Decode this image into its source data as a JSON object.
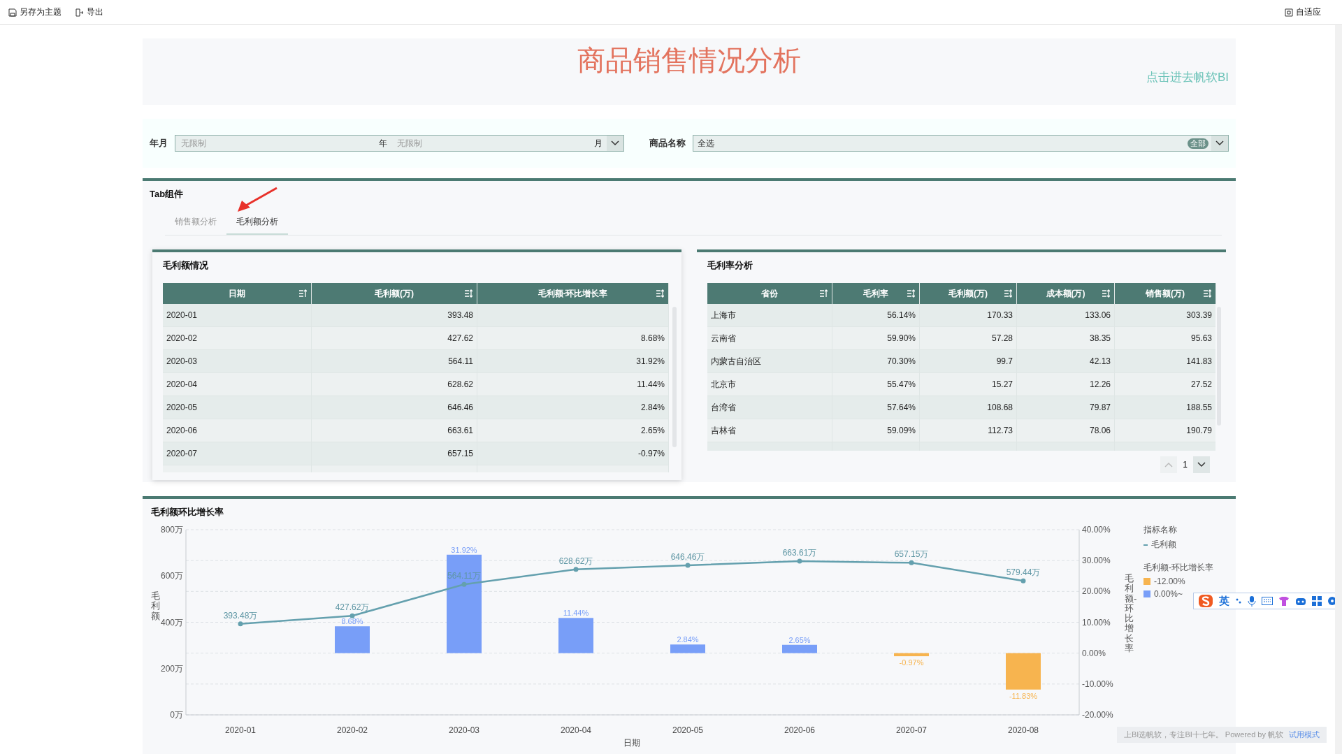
{
  "toolbar": {
    "left": [
      {
        "label": "另存为主题",
        "kind": "save"
      },
      {
        "label": "导出",
        "kind": "export"
      }
    ],
    "right": {
      "label": "自适应",
      "kind": "fit"
    }
  },
  "header": {
    "title": "商品销售情况分析",
    "link": "点击进去帆软BI"
  },
  "filters": [
    {
      "label": "年月",
      "kind": "range",
      "from": {
        "placeholder": "无限制",
        "unit": "年"
      },
      "to": {
        "placeholder": "无限制",
        "unit": "月"
      }
    },
    {
      "label": "商品名称",
      "kind": "select",
      "value": "全选",
      "badge": "全部"
    }
  ],
  "tab_panel": {
    "title": "Tab组件",
    "tabs": [
      {
        "label": "销售额分析",
        "selected": false
      },
      {
        "label": "毛利额分析",
        "selected": true
      }
    ]
  },
  "tables": [
    {
      "title": "毛利额情况",
      "columns": [
        {
          "label": "日期",
          "sorted": true
        },
        {
          "label": "毛利额(万)",
          "sorted": false
        },
        {
          "label": "毛利额-环比增长率",
          "sorted": false
        }
      ],
      "rows": [
        [
          "2020-01",
          "393.48",
          ""
        ],
        [
          "2020-02",
          "427.62",
          "8.68%"
        ],
        [
          "2020-03",
          "564.11",
          "31.92%"
        ],
        [
          "2020-04",
          "628.62",
          "11.44%"
        ],
        [
          "2020-05",
          "646.46",
          "2.84%"
        ],
        [
          "2020-06",
          "663.61",
          "2.65%"
        ],
        [
          "2020-07",
          "657.15",
          "-0.97%"
        ]
      ]
    },
    {
      "title": "毛利率分析",
      "columns": [
        {
          "label": "省份",
          "sorted": true
        },
        {
          "label": "毛利率",
          "sorted": false
        },
        {
          "label": "毛利额(万)",
          "sorted": false
        },
        {
          "label": "成本额(万)",
          "sorted": false
        },
        {
          "label": "销售额(万)",
          "sorted": false
        }
      ],
      "rows": [
        [
          "上海市",
          "56.14%",
          "170.33",
          "133.06",
          "303.39"
        ],
        [
          "云南省",
          "59.90%",
          "57.28",
          "38.35",
          "95.63"
        ],
        [
          "内蒙古自治区",
          "70.30%",
          "99.7",
          "42.13",
          "141.83"
        ],
        [
          "北京市",
          "55.47%",
          "15.27",
          "12.26",
          "27.52"
        ],
        [
          "台湾省",
          "57.64%",
          "108.68",
          "79.87",
          "188.55"
        ],
        [
          "吉林省",
          "59.09%",
          "112.73",
          "78.06",
          "190.79"
        ]
      ],
      "pager": {
        "page": "1"
      }
    }
  ],
  "chart_panel": {
    "title": "毛利额环比增长率",
    "legend": {
      "title": "指标名称",
      "bar_title": "毛利额-环比增长率"
    },
    "bar_layer": {
      "chart_data": {
        "type": "bar",
        "ylabel": "毛利额-环比增长率",
        "grid": true,
        "ylim": [
          -20,
          40
        ],
        "yticks": [
          {
            "value": -20,
            "label": "-20.00%"
          },
          {
            "value": -10,
            "label": "-10.00%"
          },
          {
            "value": 0,
            "label": "0.00%"
          },
          {
            "value": 10,
            "label": "10.00%"
          },
          {
            "value": 20,
            "label": "20.00%"
          },
          {
            "value": 30,
            "label": "30.00%"
          },
          {
            "value": 40,
            "label": "40.00%"
          }
        ],
        "series": [
          {
            "name": "-12.00%",
            "color": "#f7b44f",
            "values": [
              null,
              null,
              null,
              null,
              null,
              null,
              -1.0,
              -11.8
            ]
          },
          {
            "name": "0.00%~",
            "color": "#789ef8",
            "values": [
              null,
              8.7,
              31.9,
              11.4,
              2.8,
              2.7,
              null,
              null
            ]
          }
        ],
        "value_labels": [
          null,
          "8.68%",
          "31.92%",
          "11.44%",
          "2.84%",
          "2.65%",
          "-0.97%",
          "-11.83%"
        ]
      }
    },
    "line_layer": {
      "chart_data": {
        "type": "line",
        "xlabel": "日期",
        "ylabel": "毛利额",
        "categories": [
          "2020-01",
          "2020-02",
          "2020-03",
          "2020-04",
          "2020-05",
          "2020-06",
          "2020-07",
          "2020-08"
        ],
        "ylim": [
          0,
          800
        ],
        "yticks": [
          {
            "value": 0,
            "label": "0万"
          },
          {
            "value": 200,
            "label": "200万"
          },
          {
            "value": 400,
            "label": "400万"
          },
          {
            "value": 600,
            "label": "600万"
          },
          {
            "value": 800,
            "label": "800万"
          }
        ],
        "series": [
          {
            "name": "毛利额",
            "color": "#64a0ae",
            "marker": "circle",
            "values": [
              393,
              428,
              564,
              629,
              646,
              664,
              657,
              579
            ]
          }
        ],
        "value_labels": [
          "393.48万",
          "427.62万",
          "564.11万",
          "628.62万",
          "646.46万",
          "663.61万",
          "657.15万",
          "579.44万"
        ]
      }
    }
  },
  "ime_bar": {
    "label": "英"
  },
  "footer": {
    "text": "上BI选帆软，专注BI十七年。 Powered by 帆软",
    "link": "试用模式"
  }
}
